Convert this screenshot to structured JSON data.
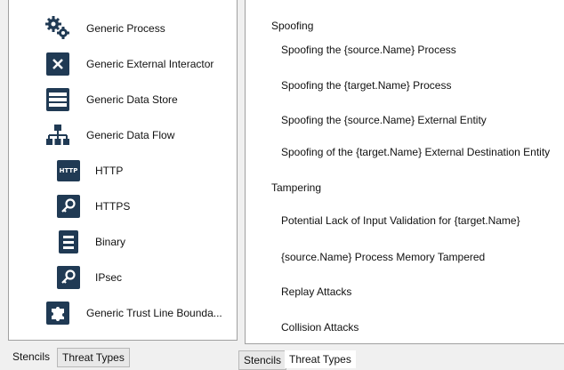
{
  "stencils": [
    {
      "label": "Generic Process",
      "icon": "gears-icon"
    },
    {
      "label": "Generic External Interactor",
      "icon": "external-interactor-icon"
    },
    {
      "label": "Generic Data Store",
      "icon": "data-store-icon"
    },
    {
      "label": "Generic Data Flow",
      "icon": "data-flow-icon"
    },
    {
      "label": "HTTP",
      "icon": "http-icon"
    },
    {
      "label": "HTTPS",
      "icon": "https-icon"
    },
    {
      "label": "Binary",
      "icon": "binary-icon"
    },
    {
      "label": "IPsec",
      "icon": "ipsec-icon"
    },
    {
      "label": "Generic Trust Line Bounda...",
      "icon": "trust-boundary-icon"
    }
  ],
  "threat_groups": [
    {
      "header": "Spoofing",
      "items": [
        "Spoofing the {source.Name} Process",
        "Spoofing the {target.Name} Process",
        "Spoofing the {source.Name} External Entity",
        "Spoofing of the {target.Name} External Destination Entity"
      ]
    },
    {
      "header": "Tampering",
      "items": [
        "Potential Lack of Input Validation for {target.Name}",
        "{source.Name} Process Memory Tampered",
        "Replay Attacks",
        "Collision Attacks"
      ]
    }
  ],
  "left_tabs": [
    "Stencils",
    "Threat Types"
  ],
  "right_tabs": [
    "Stencils",
    "Threat Types"
  ],
  "colors": {
    "icon_bg": "#203a54",
    "panel_bg": "#ffffff",
    "window_bg": "#f0f0f0"
  }
}
